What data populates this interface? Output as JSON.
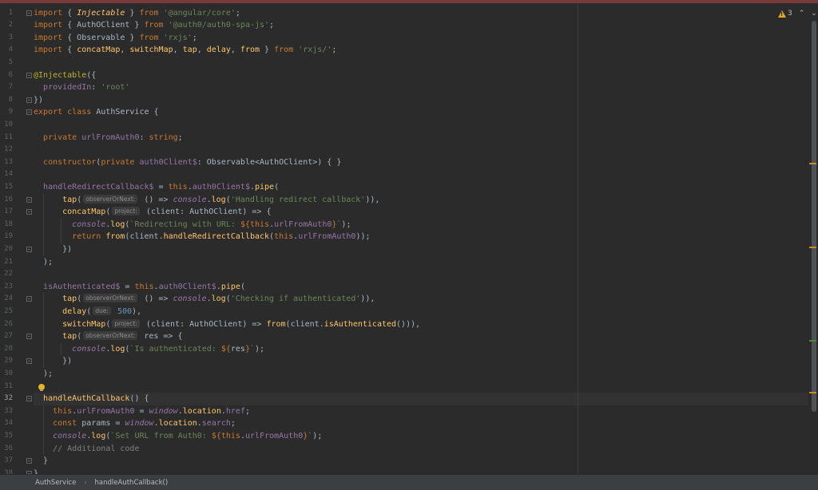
{
  "editor": {
    "line_numbers": [
      "1",
      "2",
      "3",
      "4",
      "5",
      "6",
      "7",
      "8",
      "9",
      "10",
      "11",
      "12",
      "13",
      "14",
      "15",
      "16",
      "17",
      "18",
      "19",
      "20",
      "21",
      "22",
      "23",
      "24",
      "25",
      "26",
      "27",
      "28",
      "29",
      "30",
      "31",
      "32",
      "33",
      "34",
      "35",
      "36",
      "37",
      "38"
    ],
    "active_line": "32",
    "hints": {
      "observer": "observerOrNext:",
      "project": "project:",
      "due": "due:"
    },
    "code": {
      "l1": [
        "import",
        " { ",
        "Injectable",
        " } ",
        "from",
        " ",
        "'@angular/core'",
        ";"
      ],
      "l2": [
        "import",
        " { AuthOClient } ",
        "from",
        " ",
        "'@auth0/auth0-spa-js'",
        ";"
      ],
      "l3": [
        "import",
        " { Observable } ",
        "from",
        " ",
        "'rxjs'",
        ";"
      ],
      "l4": [
        "import",
        " { ",
        "concatMap",
        ", ",
        "switchMap",
        ", ",
        "tap",
        ", ",
        "delay",
        ", ",
        "from",
        " } ",
        "from",
        " ",
        "'rxjs/'",
        ";"
      ],
      "l6": [
        "@Injectable",
        "({"
      ],
      "l7": [
        "  ",
        "providedIn",
        ": ",
        "'root'"
      ],
      "l8": [
        "})"
      ],
      "l9": [
        "export class",
        " AuthService {"
      ],
      "l11": [
        "  ",
        "private",
        " ",
        "urlFromAuth0",
        ": ",
        "string",
        ";"
      ],
      "l13": [
        "  ",
        "constructor",
        "(",
        "private",
        " ",
        "auth0Client$",
        ": Observable<AuthOClient>) { }"
      ],
      "l15": [
        "  ",
        "handleRedirectCallback$",
        " = ",
        "this",
        ".",
        "auth0Client$",
        ".",
        "pipe",
        "("
      ],
      "l16": [
        "      ",
        "tap",
        "(",
        " () => ",
        "console",
        ".",
        "log",
        "(",
        "'Handling redirect callback'",
        ")),"
      ],
      "l17": [
        "      ",
        "concatMap",
        "(",
        " (client: AuthOClient) => {"
      ],
      "l18": [
        "        ",
        "console",
        ".",
        "log",
        "(",
        "`Redirecting with URL: ",
        "${",
        "this",
        ".",
        "urlFromAuth0",
        "}",
        "`",
        ");"
      ],
      "l19": [
        "        ",
        "return",
        " ",
        "from",
        "(client.",
        "handleRedirectCallback",
        "(",
        "this",
        ".",
        "urlFromAuth0",
        "));"
      ],
      "l20": [
        "      })"
      ],
      "l21": [
        "  );"
      ],
      "l23": [
        "  ",
        "isAuthenticated$",
        " = ",
        "this",
        ".",
        "auth0Client$",
        ".",
        "pipe",
        "("
      ],
      "l24": [
        "      ",
        "tap",
        "(",
        " () => ",
        "console",
        ".",
        "log",
        "(",
        "'Checking if authenticated'",
        ")),"
      ],
      "l25": [
        "      ",
        "delay",
        "(",
        " ",
        "500",
        "),"
      ],
      "l26": [
        "      ",
        "switchMap",
        "(",
        " (client: AuthOClient) => ",
        "from",
        "(client.",
        "isAuthenticated",
        "())),"
      ],
      "l27": [
        "      ",
        "tap",
        "(",
        " res => {"
      ],
      "l28": [
        "        ",
        "console",
        ".",
        "log",
        "(",
        "`Is authenticated: ",
        "${",
        "res",
        "}",
        "`",
        ");"
      ],
      "l29": [
        "      })"
      ],
      "l30": [
        "  );"
      ],
      "l32": [
        "  ",
        "handleAuthCallback",
        "() {"
      ],
      "l33": [
        "    ",
        "this",
        ".",
        "urlFromAuth0",
        " = ",
        "window",
        ".",
        "location",
        ".",
        "href",
        ";"
      ],
      "l34": [
        "    ",
        "const",
        " params = ",
        "window",
        ".",
        "location",
        ".",
        "search",
        ";"
      ],
      "l35": [
        "    ",
        "console",
        ".",
        "log",
        "(",
        "`Set URL from Auth0: ",
        "${",
        "this",
        ".",
        "urlFromAuth0",
        "}",
        "`",
        ");"
      ],
      "l36": [
        "    ",
        "// Additional code"
      ],
      "l37": [
        "  }"
      ],
      "l38": [
        "}"
      ]
    }
  },
  "inspections": {
    "warning_count": "3",
    "up": "⌃",
    "down": "⌄"
  },
  "colors": {
    "keyword": "#cc7832",
    "string": "#6a8759",
    "function": "#ffc66d",
    "field": "#9876aa",
    "number": "#6897bb",
    "warning": "#e0a72a"
  },
  "breadcrumb": {
    "class_name": "AuthService",
    "method_name": "handleAuthCallback()"
  }
}
